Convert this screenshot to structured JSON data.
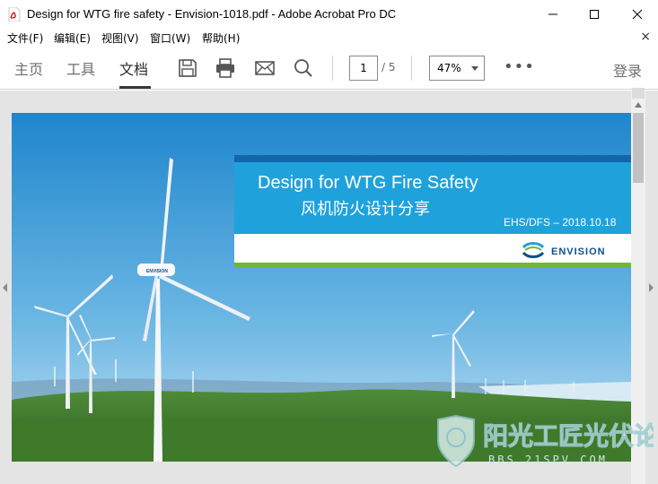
{
  "window": {
    "title": "Design for WTG fire safety - Envision-1018.pdf - Adobe Acrobat Pro DC"
  },
  "menu": {
    "items": [
      "文件(F)",
      "编辑(E)",
      "视图(V)",
      "窗口(W)",
      "帮助(H)"
    ]
  },
  "toolbar": {
    "tabs": [
      "主页",
      "工具",
      "文档"
    ],
    "active_tab": "文档",
    "page_current": "1",
    "page_total": "/ 5",
    "zoom": "47%",
    "more": "•••",
    "login": "登录"
  },
  "slide": {
    "title": "Design for WTG Fire Safety",
    "subtitle": "风机防火设计分享",
    "date": "EHS/DFS – 2018.10.18",
    "brand": "ENVISION"
  },
  "watermark": {
    "site": "BBS.21SPV.COM"
  },
  "colors": {
    "banner_blue": "#1fa2dc",
    "banner_dark": "#1366a9",
    "banner_green": "#71b832",
    "sky_top": "#1f86cc",
    "hill": "#3a7a2c"
  },
  "icons": [
    "pdf-file-icon",
    "save-icon",
    "print-icon",
    "mail-icon",
    "search-icon",
    "minimize-icon",
    "maximize-icon",
    "close-icon"
  ]
}
